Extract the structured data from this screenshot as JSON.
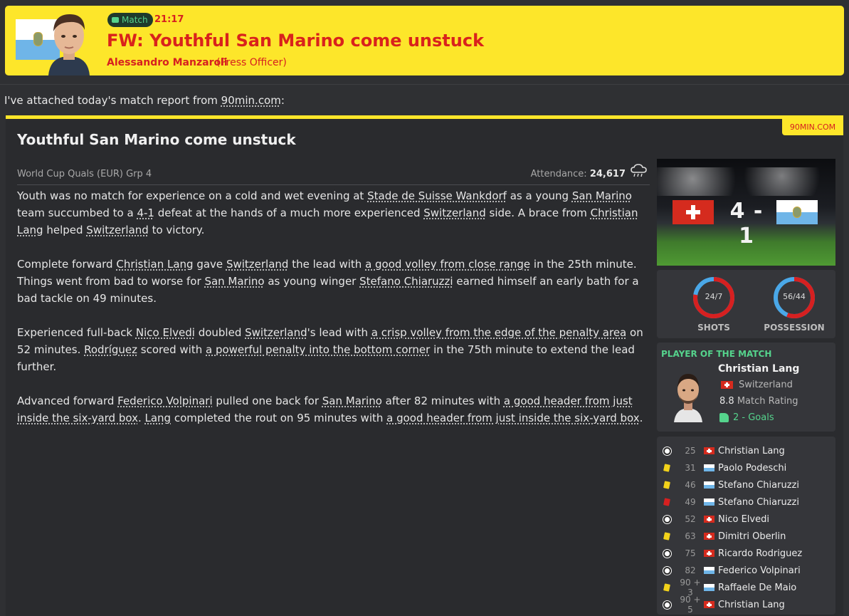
{
  "header": {
    "badge": "Match",
    "time": "21:17",
    "title": "FW: Youthful San Marino come unstuck",
    "sender": "Alessandro Manzaroli",
    "role": "(Press Officer)"
  },
  "intro": {
    "prefix": "I've attached today's match report from ",
    "source": "90min.com",
    "suffix": ":"
  },
  "report": {
    "source_tag": "90MIN.COM",
    "title": "Youthful San Marino come unstuck",
    "competition": "World Cup Quals (EUR) Grp 4",
    "attendance_label": "Attendance:",
    "attendance": "24,617",
    "paragraphs": [
      [
        "Youth was no match for experience on a cold and wet evening at ",
        {
          "u": "Stade de Suisse Wankdorf"
        },
        " as a young ",
        {
          "u": "San Marino"
        },
        " team succumbed to a ",
        {
          "u": "4-1"
        },
        " defeat at the hands of a much more experienced ",
        {
          "u": "Switzerland"
        },
        " side. A brace from ",
        {
          "u": "Christian Lang"
        },
        " helped ",
        {
          "u": "Switzerland"
        },
        " to victory."
      ],
      [
        "Complete forward ",
        {
          "u": "Christian Lang"
        },
        " gave ",
        {
          "u": "Switzerland"
        },
        " the lead with ",
        {
          "u": "a good volley from close range"
        },
        " in the 25th minute. Things went from bad to worse for ",
        {
          "u": "San Marino"
        },
        " as young winger ",
        {
          "u": "Stefano Chiaruzzi"
        },
        " earned himself an early bath for a bad tackle on 49 minutes."
      ],
      [
        "Experienced full-back ",
        {
          "u": "Nico Elvedi"
        },
        " doubled ",
        {
          "u": "Switzerland"
        },
        "'s lead with ",
        {
          "u": "a crisp volley from the edge of the penalty area"
        },
        " on 52 minutes. ",
        {
          "u": "Rodríguez"
        },
        " scored with ",
        {
          "u": "a powerful penalty into the bottom corner"
        },
        " in the 75th minute to extend the lead further."
      ],
      [
        "Advanced forward ",
        {
          "u": "Federico Volpinari"
        },
        " pulled one back for ",
        {
          "u": "San Marino"
        },
        " after 82 minutes with ",
        {
          "u": "a good header from just inside the six-yard box"
        },
        ". ",
        {
          "u": "Lang"
        },
        " completed the rout on 95 minutes with ",
        {
          "u": "a good header from just inside the six-yard box"
        },
        "."
      ]
    ]
  },
  "score": "4 - 1",
  "stats": {
    "shots": {
      "label": "SHOTS",
      "text": "24/7",
      "home": 24,
      "away": 7,
      "home_color": "#d62020",
      "away_color": "#4aa8e8"
    },
    "possession": {
      "label": "POSSESSION",
      "text": "56/44",
      "home": 56,
      "away": 44,
      "home_color": "#d62020",
      "away_color": "#4aa8e8"
    }
  },
  "potm": {
    "header": "PLAYER OF THE MATCH",
    "name": "Christian Lang",
    "nation": "Switzerland",
    "rating": "8.8",
    "rating_label": "Match Rating",
    "goals": "2 - Goals"
  },
  "events": [
    {
      "icon": "ball",
      "minute": "25",
      "team": "SUI",
      "player": "Christian Lang"
    },
    {
      "icon": "yellow",
      "minute": "31",
      "team": "SMR",
      "player": "Paolo Podeschi"
    },
    {
      "icon": "yellow",
      "minute": "46",
      "team": "SMR",
      "player": "Stefano Chiaruzzi"
    },
    {
      "icon": "red",
      "minute": "49",
      "team": "SMR",
      "player": "Stefano Chiaruzzi"
    },
    {
      "icon": "ball",
      "minute": "52",
      "team": "SUI",
      "player": "Nico Elvedi"
    },
    {
      "icon": "yellow",
      "minute": "63",
      "team": "SUI",
      "player": "Dimitri Oberlin"
    },
    {
      "icon": "ball",
      "minute": "75",
      "team": "SUI",
      "player": "Ricardo Rodriguez"
    },
    {
      "icon": "ball",
      "minute": "82",
      "team": "SMR",
      "player": "Federico Volpinari"
    },
    {
      "icon": "yellow",
      "minute": "90 + 3",
      "team": "SMR",
      "player": "Raffaele De Maio"
    },
    {
      "icon": "ball",
      "minute": "90 + 5",
      "team": "SUI",
      "player": "Christian Lang"
    }
  ]
}
